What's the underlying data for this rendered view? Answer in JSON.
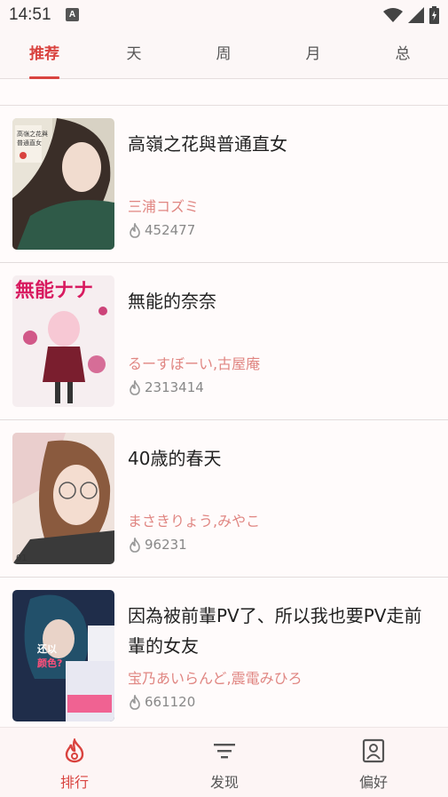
{
  "status_bar": {
    "time": "14:51",
    "notification_letter": "A"
  },
  "tabs": [
    {
      "label": "推荐",
      "active": true
    },
    {
      "label": "天",
      "active": false
    },
    {
      "label": "周",
      "active": false
    },
    {
      "label": "月",
      "active": false
    },
    {
      "label": "总",
      "active": false
    }
  ],
  "items": [
    {
      "title": "高嶺之花與普通直女",
      "author": "三浦コズミ",
      "hot": "452477",
      "cover_color": "#3c4a3e",
      "cover_text": "高嶺之花與普通直女"
    },
    {
      "title": "無能的奈奈",
      "author": "るーすぼーい,古屋庵",
      "hot": "2313414",
      "cover_color": "#f3e8ea",
      "cover_text": "無能なナナ"
    },
    {
      "title": "40歳的春天",
      "author": "まさきりょう,みやこ",
      "hot": "96231",
      "cover_color": "#e8d9d4",
      "cover_text": "01"
    },
    {
      "title": "因為被前輩PV了、所以我也要PV走前輩的女友",
      "author": "宝乃あいらんど,震電みひろ",
      "hot": "661120",
      "cover_color": "#2a3b5a",
      "cover_text": "還以顏色?"
    }
  ],
  "bottom_nav": [
    {
      "label": "排行",
      "icon": "flame-icon",
      "active": true
    },
    {
      "label": "发现",
      "icon": "filter-icon",
      "active": false
    },
    {
      "label": "偏好",
      "icon": "profile-icon",
      "active": false
    }
  ],
  "colors": {
    "accent": "#d9433f",
    "author": "#e08682"
  }
}
